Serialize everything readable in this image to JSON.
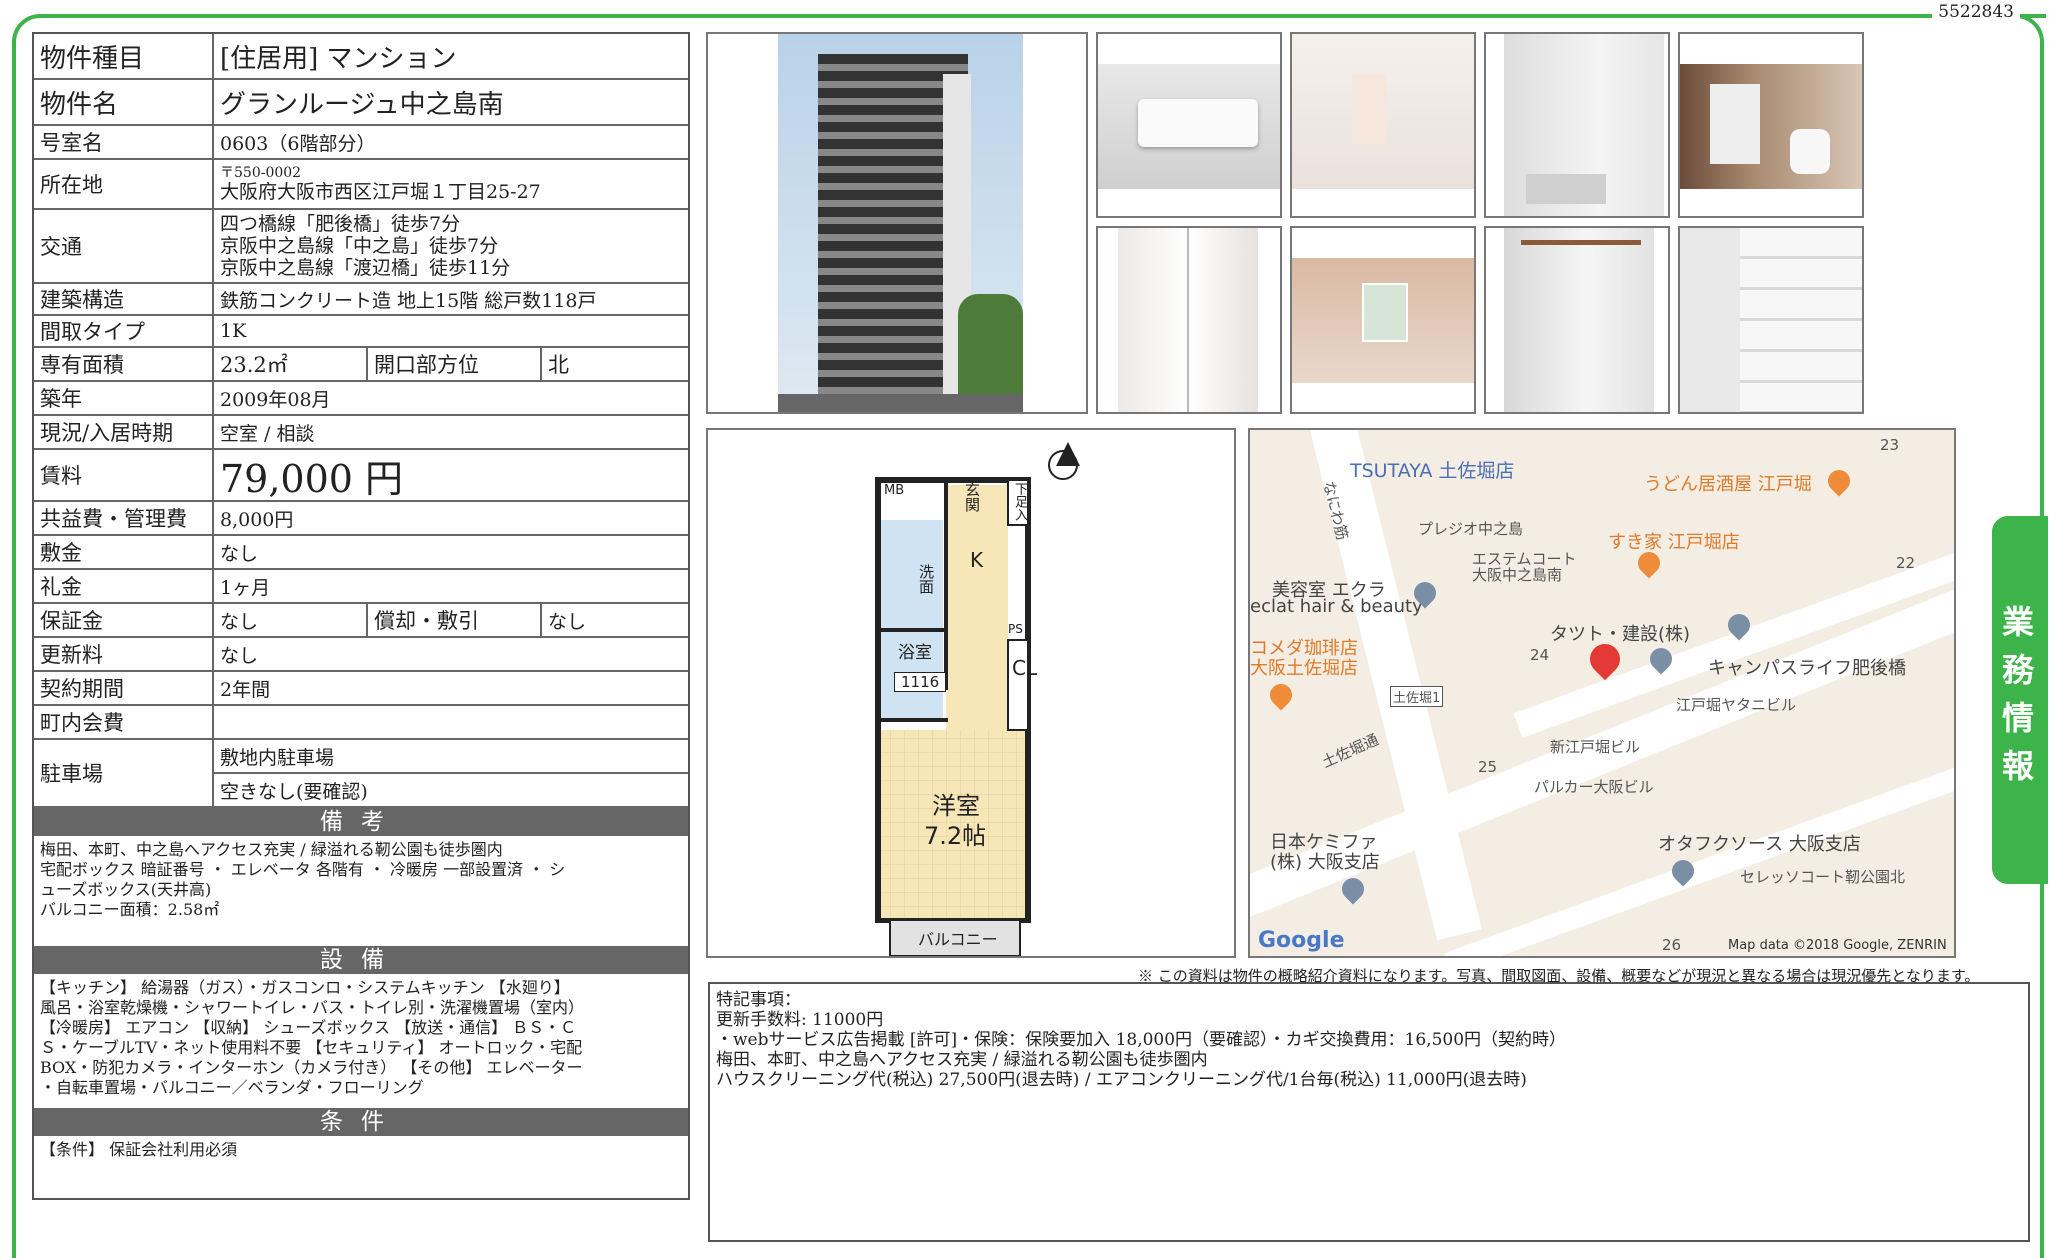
{
  "doc_id": "5522843",
  "side_tab": "業務情報",
  "property": {
    "type_label": "物件種目",
    "type_value": "[住居用] マンション",
    "name_label": "物件名",
    "name_value": "グランルージュ中之島南",
    "room_label": "号室名",
    "room_value": "0603（6階部分）",
    "address_label": "所在地",
    "address_zip": "〒550-0002",
    "address_value": "大阪府大阪市西区江戸堀１丁目25-27",
    "transport_label": "交通",
    "transport": [
      "四つ橋線「肥後橋」徒歩7分",
      "京阪中之島線「中之島」徒歩7分",
      "京阪中之島線「渡辺橋」徒歩11分"
    ],
    "structure_label": "建築構造",
    "structure_value": "鉄筋コンクリート造 地上15階 総戸数118戸",
    "layout_label": "間取タイプ",
    "layout_value": "1K",
    "area_label": "専有面積",
    "area_value": "23.2㎡",
    "direction_label": "開口部方位",
    "direction_value": "北",
    "built_label": "築年",
    "built_value": "2009年08月",
    "status_label": "現況/入居時期",
    "status_value": "空室 / 相談",
    "rent_label": "賃料",
    "rent_value": "79,000 円",
    "fee_label": "共益費・管理費",
    "fee_value": "8,000円",
    "deposit_label": "敷金",
    "deposit_value": "なし",
    "key_money_label": "礼金",
    "key_money_value": "1ヶ月",
    "guarantee_label": "保証金",
    "guarantee_value": "なし",
    "amort_label": "償却・敷引",
    "amort_value": "なし",
    "renewal_label": "更新料",
    "renewal_value": "なし",
    "contract_label": "契約期間",
    "contract_value": "2年間",
    "assoc_label": "町内会費",
    "assoc_value": "",
    "parking_label": "駐車場",
    "parking_value1": "敷地内駐車場",
    "parking_value2": "空きなし(要確認)"
  },
  "remarks": {
    "header": "備考",
    "lines": [
      "梅田、本町、中之島へアクセス充実 / 緑溢れる靭公園も徒歩圏内",
      "宅配ボックス 暗証番号 ・ エレベータ 各階有 ・ 冷暖房 一部設置済 ・ シ",
      "ューズボックス(天井高)",
      "バルコニー面積：2.58㎡"
    ]
  },
  "equipment": {
    "header": "設備",
    "lines": [
      "【キッチン】 給湯器（ガス）・ガスコンロ・システムキッチン 【水廻り】",
      "風呂・浴室乾燥機・シャワートイレ・バス・トイレ別・洗濯機置場（室内）",
      "【冷暖房】 エアコン 【収納】 シューズボックス 【放送・通信】 ＢＳ・Ｃ",
      "Ｓ・ケーブルTV・ネット使用料不要 【セキュリティ】 オートロック・宅配",
      "BOX・防犯カメラ・インターホン（カメラ付き） 【その他】 エレベーター",
      "・自転車置場・バルコニー／ベランダ・フローリング"
    ]
  },
  "conditions": {
    "header": "条件",
    "lines": [
      "【条件】 保証会社利用必須"
    ]
  },
  "floorplan": {
    "entrance": "玄関",
    "shoes": "下足入",
    "mb": "MB",
    "kitchen": "K",
    "washroom": "洗面",
    "bath": "浴室",
    "bath_size": "1116",
    "ps": "PS",
    "closet": "CL",
    "room": "洋室",
    "room_size": "7.2帖",
    "balcony": "バルコニー"
  },
  "map": {
    "labels": [
      "TSUTAYA 土佐堀店",
      "うどん居酒屋 江戸堀",
      "プレジオ中之島",
      "エステムコート",
      "大阪中之島南",
      "すき家 江戸堀店",
      "美容室 エクラ",
      "eclat hair & beauty",
      "タツト・建設(株)",
      "キャンパスライフ肥後橋",
      "コメダ珈琲店",
      "大阪土佐堀店",
      "土佐堀1",
      "江戸堀ヤタニビル",
      "新江戸堀ビル",
      "パルカー大阪ビル",
      "土佐堀通",
      "なにわ筋",
      "日本ケミファ",
      "(株) 大阪支店",
      "オタフクソース 大阪支店",
      "セレッソコート靭公園北",
      "23",
      "22",
      "24",
      "25",
      "26"
    ],
    "logo": "Google",
    "credit": "Map data ©2018 Google, ZENRIN"
  },
  "notice": "※ この資料は物件の概略紹介資料になります。写真、間取図面、設備、概要などが現況と異なる場合は現況優先となります。",
  "special_notes": {
    "title": "特記事項：",
    "lines": [
      "更新手数料: 11000円",
      "・webサービス広告掲載 [許可]・保険：保険要加入 18,000円（要確認）・カギ交換費用：16,500円（契約時）",
      "梅田、本町、中之島へアクセス充実 / 緑溢れる靭公園も徒歩圏内",
      "ハウスクリーニング代(税込) 27,500円(退去時) / エアコンクリーニング代/1台毎(税込) 11,000円(退去時)"
    ]
  }
}
